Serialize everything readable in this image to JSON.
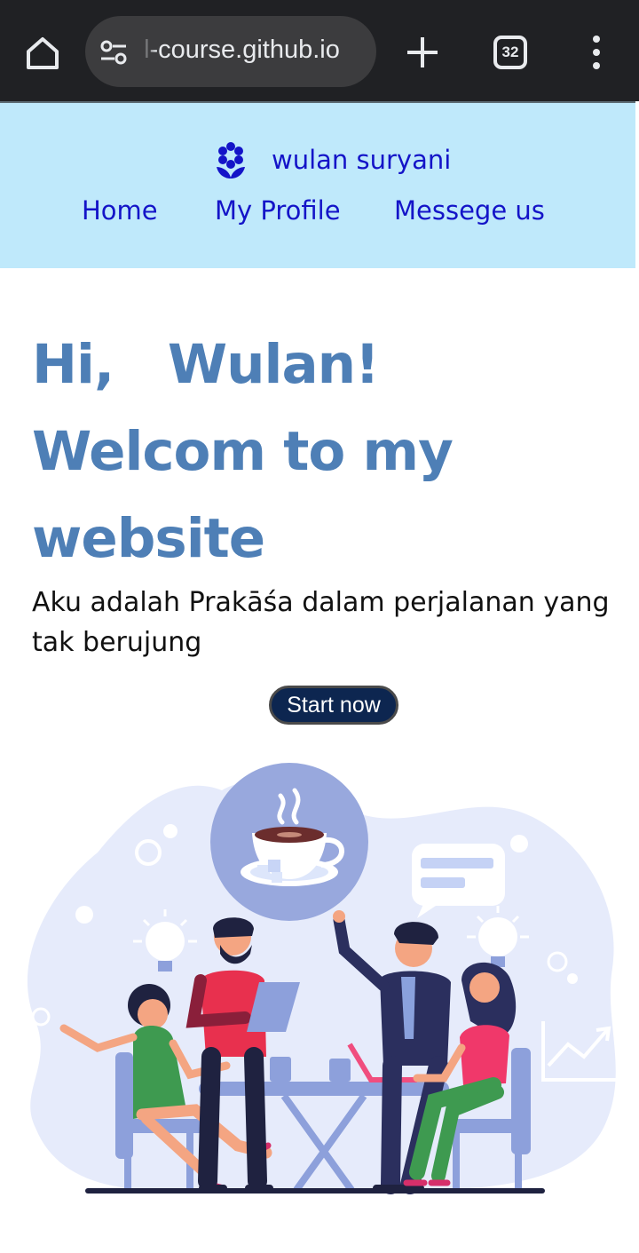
{
  "browser": {
    "url_text": "l-course.github.io",
    "tab_count": "32",
    "icons": [
      "home-icon",
      "site-settings-icon",
      "new-tab-icon",
      "tab-switcher-icon",
      "more-menu-icon"
    ]
  },
  "header": {
    "brand_name": "wulan suryani",
    "logo_icon": "flower-logo-icon",
    "nav": [
      {
        "label": "Home"
      },
      {
        "label": "My Profile"
      },
      {
        "label": "Messege us"
      }
    ]
  },
  "hero": {
    "title_lines": [
      "Hi,   Wulan!",
      "Welcom to my",
      "website"
    ],
    "subtitle": "Aku adalah Prakāśa dalam perjalanan yang tak berujung",
    "cta_label": "Start now"
  },
  "illustration": {
    "subject": "team meeting illustration",
    "accent_color": "#4e7fb6",
    "blob_color": "#e6ebfb"
  }
}
